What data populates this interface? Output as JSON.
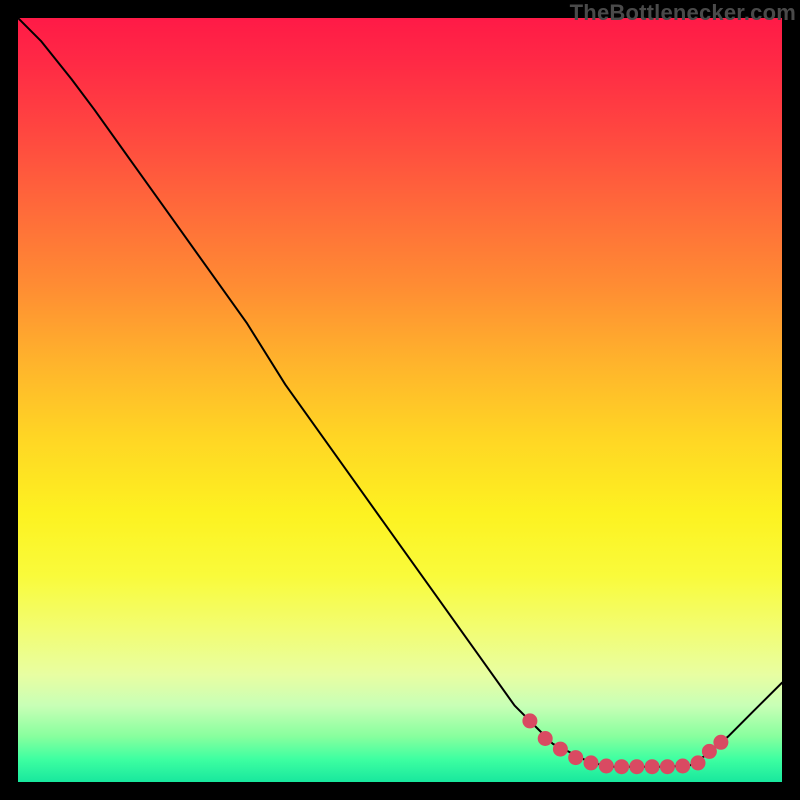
{
  "watermark": "TheBottlenecker.com",
  "colors": {
    "marker": "#d94a62",
    "curve": "#000000",
    "background": "#000000"
  },
  "chart_data": {
    "type": "line",
    "title": "",
    "xlabel": "",
    "ylabel": "",
    "xlim": [
      0,
      100
    ],
    "ylim": [
      0,
      100
    ],
    "x": [
      0,
      3,
      7,
      10,
      15,
      20,
      25,
      30,
      35,
      40,
      45,
      50,
      55,
      60,
      65,
      68,
      70,
      72,
      75,
      78,
      80,
      83,
      85,
      88,
      90,
      93,
      96,
      100
    ],
    "y": [
      100,
      97,
      92,
      88,
      81,
      74,
      67,
      60,
      52,
      45,
      38,
      31,
      24,
      17,
      10,
      7,
      5,
      4,
      2.5,
      2,
      2,
      2,
      2,
      2.2,
      3.5,
      6,
      9,
      13
    ],
    "markers_x": [
      67,
      69,
      71,
      73,
      75,
      77,
      79,
      81,
      83,
      85,
      87,
      89,
      90.5,
      92
    ],
    "markers_y": [
      8.0,
      5.7,
      4.3,
      3.2,
      2.5,
      2.1,
      2.0,
      2.0,
      2.0,
      2.0,
      2.1,
      2.5,
      4.0,
      5.2
    ],
    "grid": false,
    "legend": false
  }
}
